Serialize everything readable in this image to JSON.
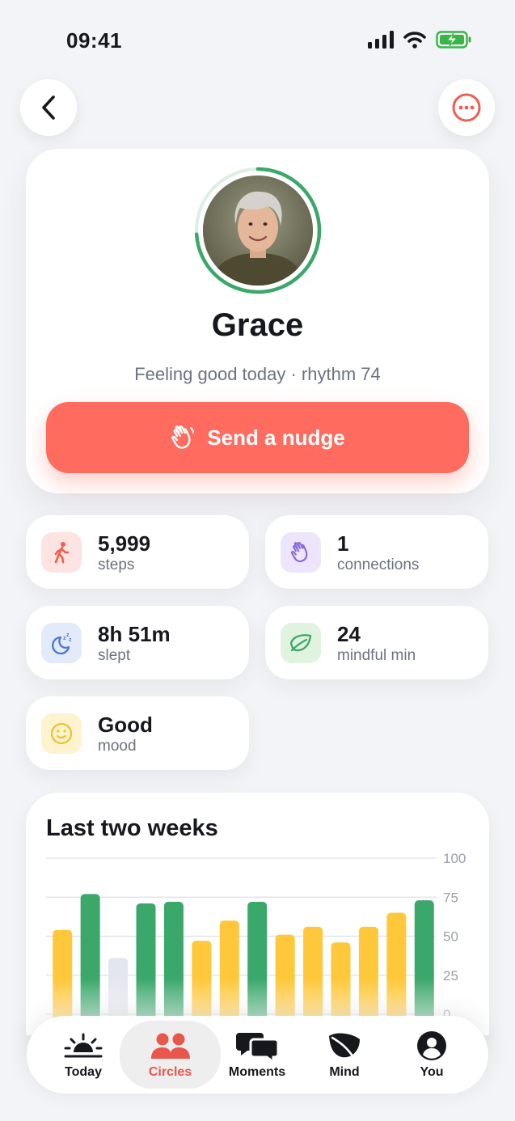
{
  "status_bar": {
    "time": "09:41"
  },
  "profile": {
    "name": "Grace",
    "subtitle": "Feeling good today · rhythm 74",
    "rhythm_score": 74,
    "nudge_label": "Send a nudge"
  },
  "stats": [
    {
      "value": "5,999",
      "label": "steps",
      "icon": "walking-icon",
      "bg": "#fde4e2",
      "color": "#ef5e52"
    },
    {
      "value": "1",
      "label": "connections",
      "icon": "waving-hand-icon",
      "bg": "#ece5fb",
      "color": "#8b68d8"
    },
    {
      "value": "8h 51m",
      "label": "slept",
      "icon": "moon-sleep-icon",
      "bg": "#e3ebfb",
      "color": "#4a76d8"
    },
    {
      "value": "24",
      "label": "mindful min",
      "icon": "leaf-icon",
      "bg": "#e0f3df",
      "color": "#3ba86b"
    },
    {
      "value": "Good",
      "label": "mood",
      "icon": "smiley-icon",
      "bg": "#fdf3cf",
      "color": "#f0c22b"
    }
  ],
  "chart": {
    "title": "Last two weeks"
  },
  "chart_data": {
    "type": "bar",
    "title": "Last two weeks",
    "ylim": [
      0,
      100
    ],
    "yticks": [
      "100",
      "75",
      "50",
      "25",
      "0"
    ],
    "values": [
      54,
      77,
      36,
      71,
      72,
      47,
      60,
      72,
      51,
      56,
      46,
      56,
      65,
      73
    ],
    "colors": [
      "#ffc83a",
      "#3ba86b",
      "#e3e6ec",
      "#3ba86b",
      "#3ba86b",
      "#ffc83a",
      "#ffc83a",
      "#3ba86b",
      "#ffc83a",
      "#ffc83a",
      "#ffc83a",
      "#ffc83a",
      "#ffc83a",
      "#3ba86b"
    ],
    "grid": true
  },
  "tabs": [
    {
      "label": "Today",
      "icon": "sunrise-icon"
    },
    {
      "label": "Circles",
      "icon": "people-icon",
      "active": true
    },
    {
      "label": "Moments",
      "icon": "chat-bubbles-icon"
    },
    {
      "label": "Mind",
      "icon": "leaf-icon"
    },
    {
      "label": "You",
      "icon": "profile-icon"
    }
  ],
  "colors": {
    "accent": "#ff6b5e",
    "green": "#3ba86b",
    "yellow": "#ffc83a"
  }
}
